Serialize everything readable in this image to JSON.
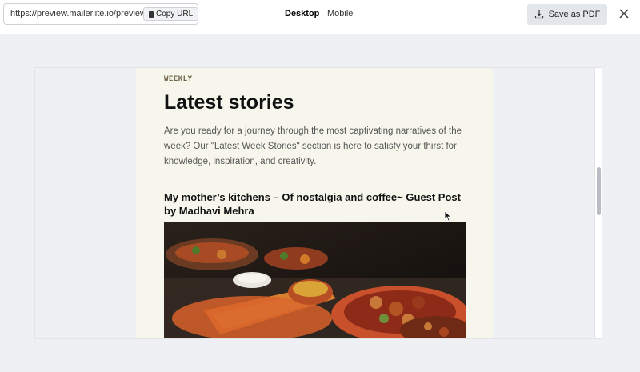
{
  "topbar": {
    "url": "https://preview.mailerlite.io/preview/",
    "copy_label": "Copy URL",
    "tabs": [
      {
        "label": "Desktop",
        "active": true
      },
      {
        "label": "Mobile",
        "active": false
      }
    ],
    "save_label": "Save as PDF",
    "icons": {
      "copy": "clipboard-icon",
      "download": "download-icon",
      "close": "close-icon"
    }
  },
  "email": {
    "kicker": "WEEKLY",
    "title": "Latest stories",
    "intro": "Are you ready for a journey through the most captivating narratives of the week? Our \"Latest Week Stories\" section is here to satisfy your thirst for knowledge, inspiration, and creativity.",
    "post_title": "My mother’s kitchens – Of nostalgia and coffee~ Guest Post by Madhavi Mehra"
  },
  "colors": {
    "email_bg": "#f6f6ec",
    "kicker": "#6b6244",
    "page_bg": "#eef0f3"
  }
}
